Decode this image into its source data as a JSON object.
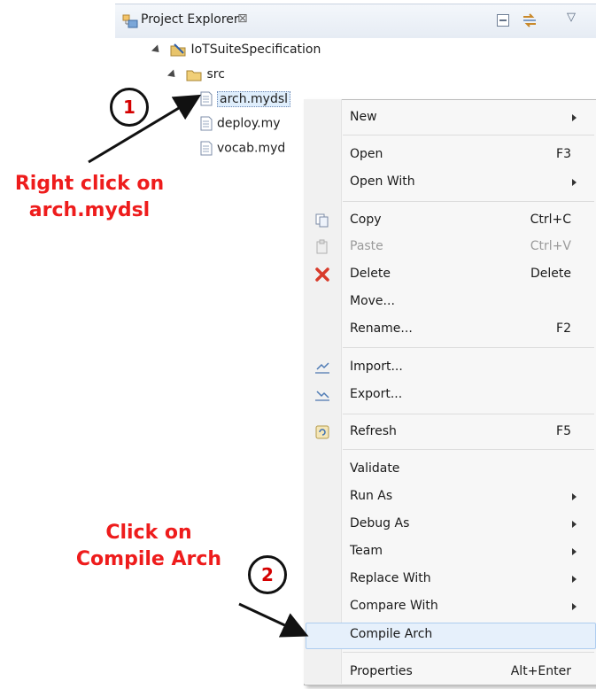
{
  "explorer": {
    "title": "Project Explorer",
    "close_glyph": "⊠",
    "tree": {
      "project": "IoTSuiteSpecification",
      "folder": "src",
      "files": [
        "arch.mydsl",
        "deploy.my",
        "vocab.myd"
      ]
    }
  },
  "context_menu": {
    "items": [
      {
        "label": "New",
        "shortcut": "",
        "submenu": true
      },
      {
        "label": "Open",
        "shortcut": "F3"
      },
      {
        "label": "Open With",
        "shortcut": "",
        "submenu": true
      },
      {
        "label": "Copy",
        "shortcut": "Ctrl+C",
        "icon": "copy-icon"
      },
      {
        "label": "Paste",
        "shortcut": "Ctrl+V",
        "icon": "paste-icon",
        "disabled": true
      },
      {
        "label": "Delete",
        "shortcut": "Delete",
        "icon": "delete-icon"
      },
      {
        "label": "Move...",
        "shortcut": ""
      },
      {
        "label": "Rename...",
        "shortcut": "F2"
      },
      {
        "label": "Import...",
        "shortcut": "",
        "icon": "import-icon"
      },
      {
        "label": "Export...",
        "shortcut": "",
        "icon": "export-icon"
      },
      {
        "label": "Refresh",
        "shortcut": "F5",
        "icon": "refresh-icon"
      },
      {
        "label": "Validate",
        "shortcut": ""
      },
      {
        "label": "Run As",
        "shortcut": "",
        "submenu": true
      },
      {
        "label": "Debug As",
        "shortcut": "",
        "submenu": true
      },
      {
        "label": "Team",
        "shortcut": "",
        "submenu": true
      },
      {
        "label": "Replace With",
        "shortcut": "",
        "submenu": true
      },
      {
        "label": "Compare With",
        "shortcut": "",
        "submenu": true
      },
      {
        "label": "Compile Arch",
        "shortcut": "",
        "highlighted": true
      },
      {
        "label": "Properties",
        "shortcut": "Alt+Enter"
      }
    ]
  },
  "annotations": {
    "step1": {
      "number": "1",
      "line1": "Right click on",
      "line2": "arch.mydsl"
    },
    "step2": {
      "number": "2",
      "line1": "Click on",
      "line2": "Compile Arch"
    }
  },
  "colors": {
    "annotation": "#ee1c1c",
    "highlight": "#e6f0fb"
  }
}
